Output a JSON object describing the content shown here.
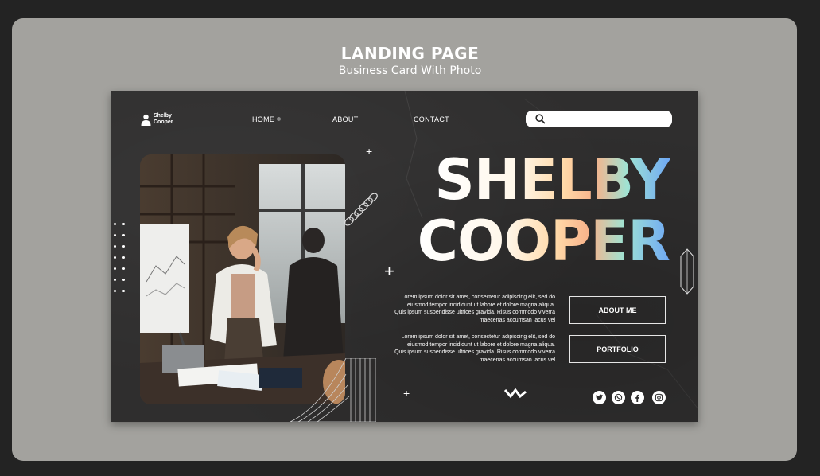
{
  "header": {
    "title": "LANDING PAGE",
    "subtitle": "Business Card With Photo"
  },
  "site": {
    "logo": {
      "line1": "Shelby",
      "line2": "Cooper",
      "icon": "person-icon"
    },
    "nav": {
      "home": "HOME",
      "about": "ABOUT",
      "contact": "CONTACT"
    },
    "search": {
      "icon": "search-icon",
      "placeholder": ""
    },
    "hero": {
      "line1": "SHELBY",
      "line2": "COOPER"
    },
    "paragraphs": [
      "Lorem ipsum dolor sit amet, consectetur adipiscing elit, sed do eiusmod tempor incididunt ut labore et dolore magna aliqua. Quis ipsum suspendisse ultrices gravida. Risus commodo viverra maecenas accumsan lacus vel",
      "Lorem ipsum dolor sit amet, consectetur adipiscing elit, sed do eiusmod tempor incididunt ut labore et dolore magna aliqua. Quis ipsum suspendisse ultrices gravida. Risus commodo viverra maecenas accumsan lacus vel"
    ],
    "buttons": {
      "about": "ABOUT ME",
      "portfolio": "PORTFOLIO"
    },
    "social": [
      "twitter-icon",
      "whatsapp-icon",
      "facebook-icon",
      "instagram-icon"
    ],
    "colors": {
      "background": "#2f2e2e",
      "frame": "#a3a29e",
      "gradient": [
        "#ffffff",
        "#ffd9a8",
        "#f8b28a",
        "#9fe3d3",
        "#6fa8f5"
      ]
    }
  }
}
